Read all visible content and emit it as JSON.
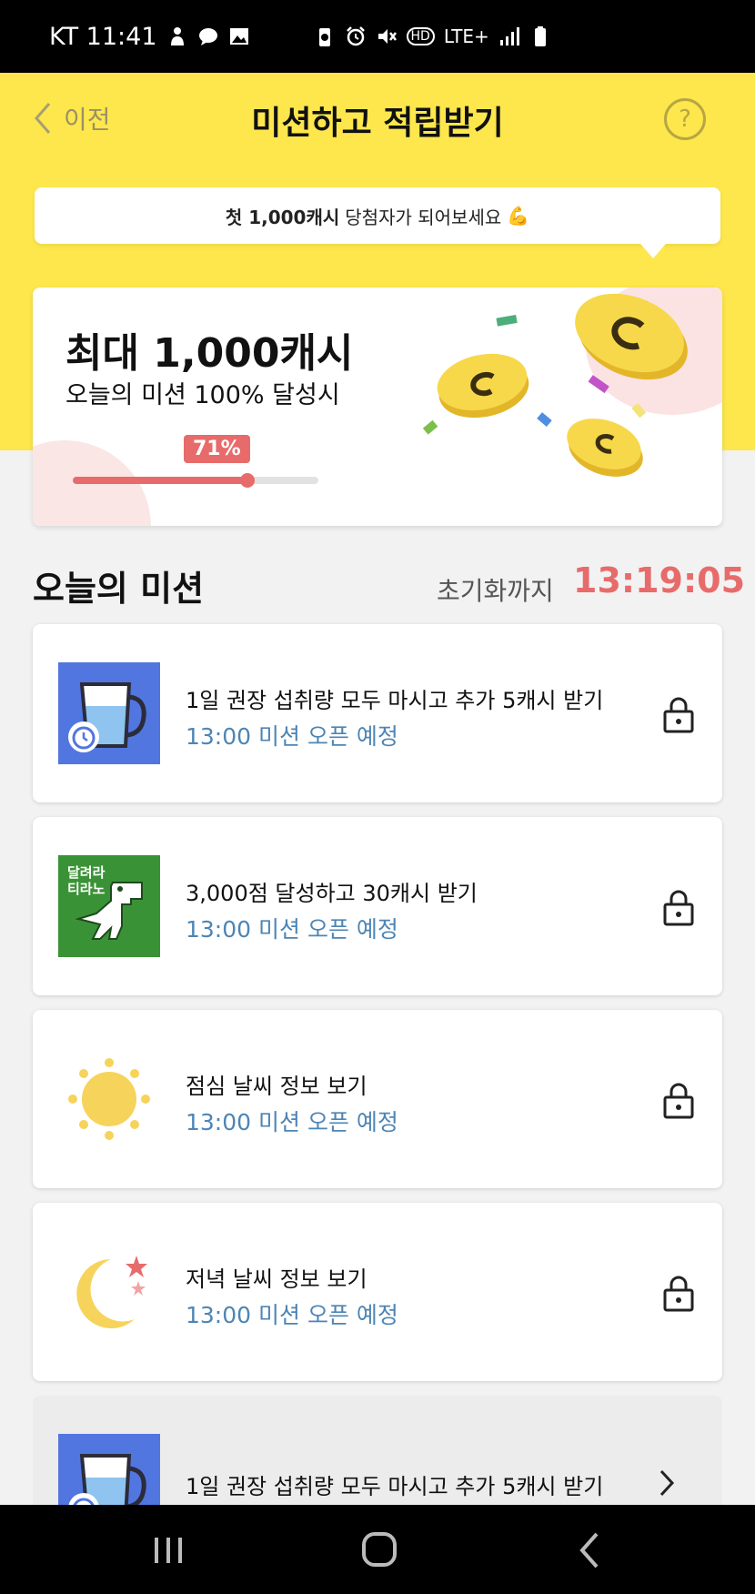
{
  "status_bar": {
    "carrier_time": "KT 11:41",
    "hd": "HD",
    "network": "LTE+",
    "icons": [
      "person-icon",
      "chat-bubble-icon",
      "image-icon",
      "battery-saver-icon",
      "alarm-icon",
      "mute-icon",
      "signal-icon",
      "battery-icon"
    ]
  },
  "header": {
    "back_label": "이전",
    "title": "미션하고 적립받기",
    "help_label": "?"
  },
  "banner": {
    "bold": "첫 1,000캐시",
    "text": "당첨자가 되어보세요",
    "emoji": "💪"
  },
  "reward_card": {
    "title": "최대 1,000캐시",
    "subtitle": "오늘의 미션 100% 달성시",
    "progress_label": "71%",
    "progress": 0.71
  },
  "missions_section": {
    "title": "오늘의 미션",
    "reset_label": "초기화까지",
    "reset_time": "13:19:05"
  },
  "missions": [
    {
      "title": "1일 권장 섭취량 모두 마시고 추가 5캐시 받기",
      "status": "13:00 미션 오픈 예정",
      "icon": "water-cup-icon",
      "action_icon": "lock-icon"
    },
    {
      "title": "3,000점 달성하고 30캐시 받기",
      "status": "13:00 미션 오픈 예정",
      "icon": "dino-game-icon",
      "icon_text_1": "달려라",
      "icon_text_2": "티라노",
      "action_icon": "lock-icon"
    },
    {
      "title": "점심 날씨 정보 보기",
      "status": "13:00 미션 오픈 예정",
      "icon": "sun-icon",
      "action_icon": "lock-icon"
    },
    {
      "title": "저녁 날씨 정보 보기",
      "status": "13:00 미션 오픈 예정",
      "icon": "moon-icon",
      "action_icon": "lock-icon"
    },
    {
      "title": "1일 권장 섭취량 모두 마시고 추가 5캐시 받기",
      "status": "",
      "icon": "water-cup-icon",
      "action_icon": "chevron-right-icon"
    }
  ],
  "colors": {
    "header_yellow": "#fde74c",
    "accent_red": "#e86b6b",
    "status_blue": "#4d85b5"
  },
  "system_nav": [
    "recent-apps-icon",
    "home-icon",
    "back-icon"
  ]
}
